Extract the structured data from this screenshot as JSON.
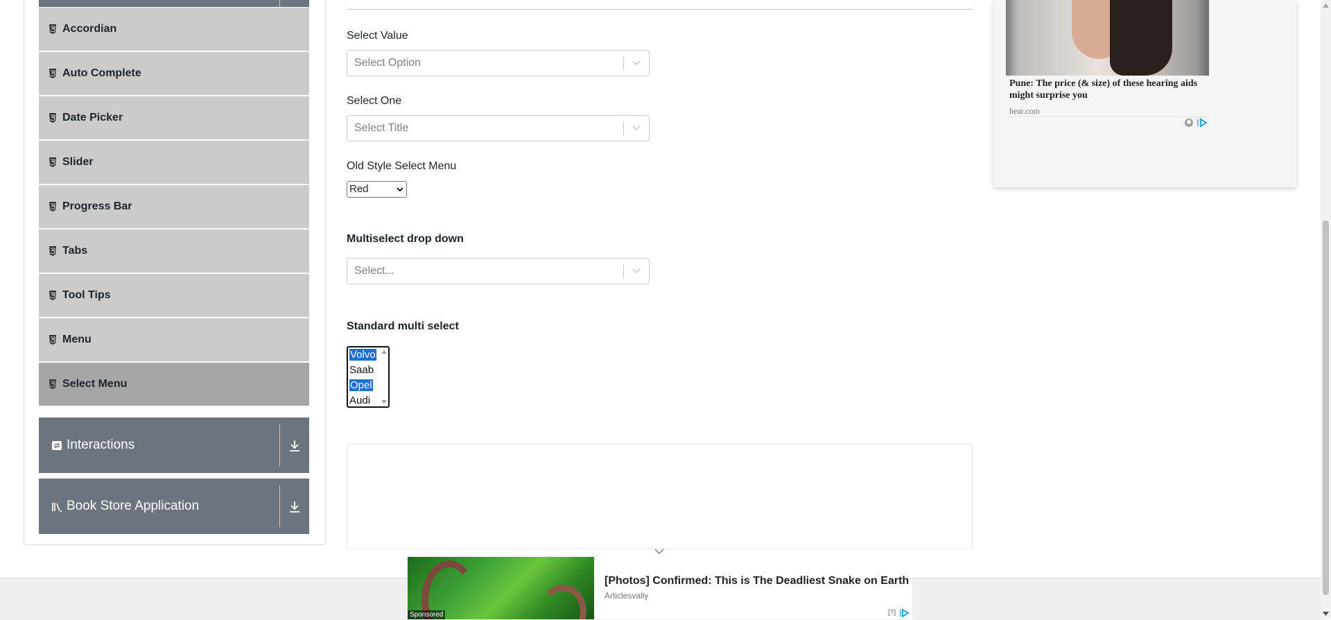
{
  "sidebar": {
    "items": [
      {
        "label": "Accordian"
      },
      {
        "label": "Auto Complete"
      },
      {
        "label": "Date Picker"
      },
      {
        "label": "Slider"
      },
      {
        "label": "Progress Bar"
      },
      {
        "label": "Tabs"
      },
      {
        "label": "Tool Tips"
      },
      {
        "label": "Menu"
      },
      {
        "label": "Select Menu",
        "active": true
      }
    ],
    "groups": [
      {
        "label": "Interactions"
      },
      {
        "label": "Book Store Application"
      }
    ]
  },
  "main": {
    "select_value": {
      "label": "Select Value",
      "placeholder": "Select Option"
    },
    "select_one": {
      "label": "Select One",
      "placeholder": "Select Title"
    },
    "old_style": {
      "label": "Old Style Select Menu",
      "selected": "Red"
    },
    "multiselect": {
      "label": "Multiselect drop down",
      "placeholder": "Select..."
    },
    "standard_multi": {
      "label": "Standard multi select",
      "options": [
        {
          "text": "Volvo",
          "selected": true
        },
        {
          "text": "Saab",
          "selected": false
        },
        {
          "text": "Opel",
          "selected": true
        },
        {
          "text": "Audi",
          "selected": false
        }
      ]
    }
  },
  "right_ad": {
    "text": "Pune: The price (& size) of these hearing aids might surprise you",
    "source": "hear.com"
  },
  "bottom_ad": {
    "sponsored": "Sponsored",
    "title": "[Photos] Confirmed: This is The Deadliest Snake on Earth",
    "source": "Articlesvally",
    "help": "[?]"
  },
  "colors": {
    "sidebar_item": "#cbcbcb",
    "sidebar_active": "#a6a6a6",
    "group_bg": "#6c757d",
    "option_selected": "#1e6fd6"
  }
}
